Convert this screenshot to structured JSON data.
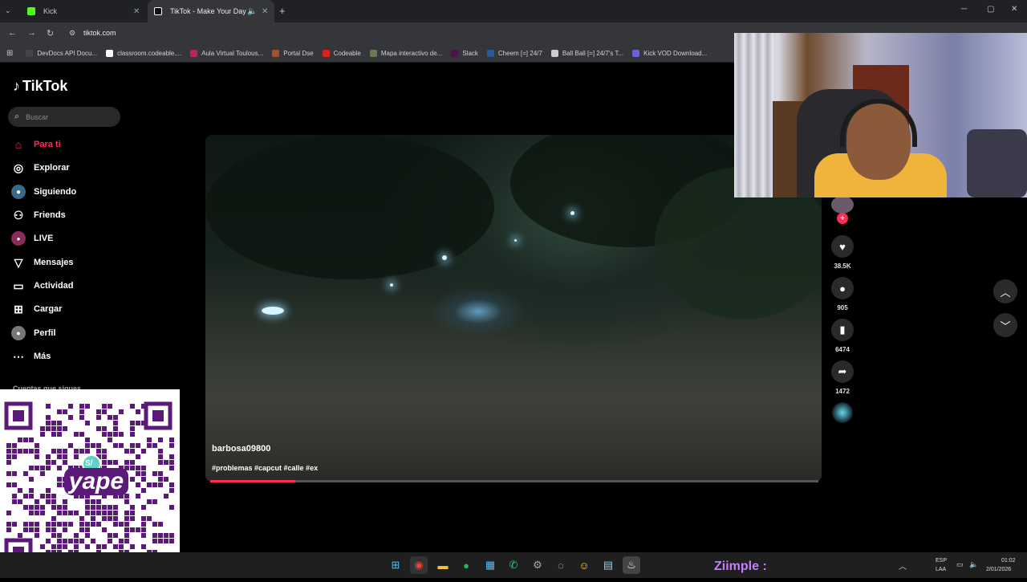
{
  "browser": {
    "tabs": [
      {
        "title": "Kick",
        "color": "#53fc18"
      },
      {
        "title": "TikTok - Make Your Day",
        "color": "#ffffff"
      }
    ],
    "url": "tiktok.com",
    "bookmarks": [
      {
        "label": "DevDocs API Docu...",
        "color": "#444"
      },
      {
        "label": "classroom.codeable....",
        "color": "#ffffff"
      },
      {
        "label": "Aula Virtual Toulous...",
        "color": "#b8245c"
      },
      {
        "label": "Portal Dse",
        "color": "#a0522d"
      },
      {
        "label": "Codeable",
        "color": "#e02020"
      },
      {
        "label": "Mapa interactivo de...",
        "color": "#6a7a50"
      },
      {
        "label": "Slack",
        "color": "#4a154b"
      },
      {
        "label": "Cheem [=] 24/7",
        "color": "#2a5a9a"
      },
      {
        "label": "Ball Ball [=] 24/7's T...",
        "color": "#cccccc"
      },
      {
        "label": "Kick VOD Download...",
        "color": "#6b5fd6"
      }
    ]
  },
  "tiktok": {
    "logo": "TikTok",
    "search_placeholder": "Buscar",
    "nav": [
      {
        "label": "Para ti",
        "icon": "home-icon"
      },
      {
        "label": "Explorar",
        "icon": "compass-icon"
      },
      {
        "label": "Siguiendo",
        "icon": "following-icon"
      },
      {
        "label": "Friends",
        "icon": "friends-icon"
      },
      {
        "label": "LIVE",
        "icon": "live-icon"
      },
      {
        "label": "Mensajes",
        "icon": "messages-icon"
      },
      {
        "label": "Actividad",
        "icon": "activity-icon"
      },
      {
        "label": "Cargar",
        "icon": "upload-icon"
      },
      {
        "label": "Perfil",
        "icon": "profile-icon"
      },
      {
        "label": "Más",
        "icon": "more-icon"
      }
    ],
    "sidebar_section": "Cuentas que sigues",
    "video": {
      "author": "barbosa09800",
      "caption": "#problemas #capcut #calle #ex",
      "progress": 0.14
    },
    "actions": {
      "likes": "38.5K",
      "comments": "905",
      "saves": "6474",
      "shares": "1472"
    }
  },
  "overlay": {
    "qr_text": "yape",
    "qr_badge": "S/",
    "ziimple": "Ziimple :"
  },
  "taskbar": {
    "lang": "ESP",
    "lang2": "LAA",
    "time": "01:02",
    "date": "2/01/2026"
  },
  "colors": {
    "accent": "#fe2c55",
    "qr": "#5b1a7a"
  }
}
